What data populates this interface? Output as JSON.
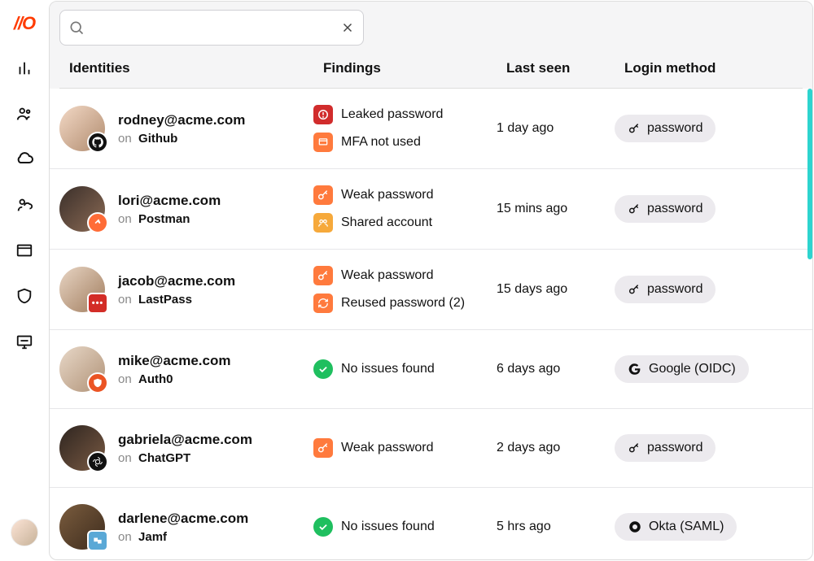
{
  "search": {
    "value": "",
    "placeholder": ""
  },
  "headers": {
    "identities": "Identities",
    "findings": "Findings",
    "last_seen": "Last seen",
    "login_method": "Login method"
  },
  "on_label": "on",
  "rows": [
    {
      "email": "rodney@acme.com",
      "provider": "Github",
      "provider_icon": "github",
      "findings": [
        {
          "label": "Leaked password",
          "severity": "red",
          "icon": "alert"
        },
        {
          "label": "MFA not used",
          "severity": "orange",
          "icon": "shield-off"
        }
      ],
      "last_seen": "1 day ago",
      "login_method": {
        "label": "password",
        "icon": "key"
      }
    },
    {
      "email": "lori@acme.com",
      "provider": "Postman",
      "provider_icon": "postman",
      "findings": [
        {
          "label": "Weak password",
          "severity": "orange",
          "icon": "key"
        },
        {
          "label": "Shared account",
          "severity": "amber",
          "icon": "users"
        }
      ],
      "last_seen": "15 mins ago",
      "login_method": {
        "label": "password",
        "icon": "key"
      }
    },
    {
      "email": "jacob@acme.com",
      "provider": "LastPass",
      "provider_icon": "lastpass",
      "findings": [
        {
          "label": "Weak password",
          "severity": "orange",
          "icon": "key"
        },
        {
          "label": "Reused password (2)",
          "severity": "orange",
          "icon": "refresh"
        }
      ],
      "last_seen": "15 days ago",
      "login_method": {
        "label": "password",
        "icon": "key"
      }
    },
    {
      "email": "mike@acme.com",
      "provider": "Auth0",
      "provider_icon": "auth0",
      "findings": [
        {
          "label": "No issues found",
          "severity": "green",
          "icon": "check"
        }
      ],
      "last_seen": "6 days ago",
      "login_method": {
        "label": "Google (OIDC)",
        "icon": "google"
      }
    },
    {
      "email": "gabriela@acme.com",
      "provider": "ChatGPT",
      "provider_icon": "chatgpt",
      "findings": [
        {
          "label": "Weak password",
          "severity": "orange",
          "icon": "key"
        }
      ],
      "last_seen": "2 days ago",
      "login_method": {
        "label": "password",
        "icon": "key"
      }
    },
    {
      "email": "darlene@acme.com",
      "provider": "Jamf",
      "provider_icon": "jamf",
      "findings": [
        {
          "label": "No issues found",
          "severity": "green",
          "icon": "check"
        }
      ],
      "last_seen": "5 hrs ago",
      "login_method": {
        "label": "Okta (SAML)",
        "icon": "okta"
      }
    }
  ]
}
